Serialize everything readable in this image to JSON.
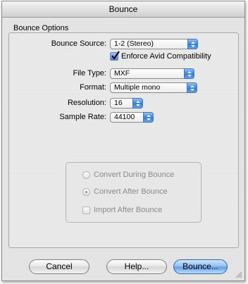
{
  "window": {
    "title": "Bounce"
  },
  "options": {
    "group_label": "Bounce Options",
    "bounce_source": {
      "label": "Bounce Source:",
      "value": "1-2 (Stereo)"
    },
    "enforce": {
      "label": "Enforce Avid Compatibility",
      "checked": true
    },
    "file_type": {
      "label": "File Type:",
      "value": "MXF"
    },
    "format": {
      "label": "Format:",
      "value": "Multiple mono"
    },
    "resolution": {
      "label": "Resolution:",
      "value": "16"
    },
    "sample_rate": {
      "label": "Sample Rate:",
      "value": "44100"
    }
  },
  "convert": {
    "during_label": "Convert During Bounce",
    "after_label": "Convert After Bounce",
    "import_label": "Import After Bounce",
    "selected": "after"
  },
  "buttons": {
    "cancel": "Cancel",
    "help": "Help...",
    "bounce": "Bounce..."
  },
  "colors": {
    "accent": "#3f86e4",
    "disabled_text": "#8a8a8a"
  }
}
